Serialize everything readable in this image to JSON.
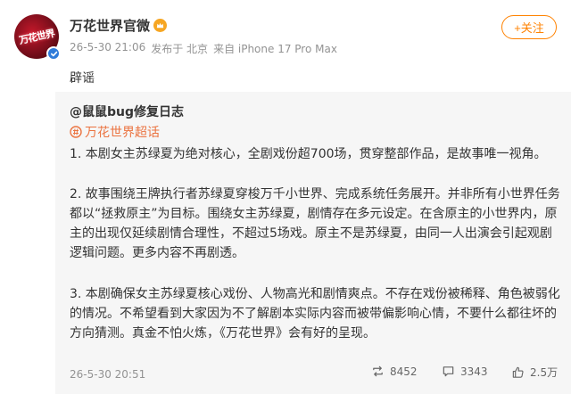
{
  "author": {
    "name": "万花世界官微",
    "avatar_text": "万花世界",
    "meta": [
      "26-5-30 21:06",
      "发布于 北京",
      "来自 iPhone 17 Pro Max"
    ]
  },
  "follow_label": "+关注",
  "post_text": "辟谣",
  "repost": {
    "author": "@鼠鼠bug修复日志",
    "topic": "万花世界超话",
    "paragraphs": [
      "1. 本剧女主苏绿夏为绝对核心，全剧戏份超700场，贯穿整部作品，是故事唯一视角。",
      "2. 故事围绕王牌执行者苏绿夏穿梭万千小世界、完成系统任务展开。并非所有小世界任务都以“拯救原主”为目标。围绕女主苏绿夏，剧情存在多元设定。在含原主的小世界内，原主的出现仅延续剧情合理性，不超过5场戏。原主不是苏绿夏，由同一人出演会引起观剧逻辑问题。更多内容不再剧透。",
      "3. 本剧确保女主苏绿夏核心戏份、人物高光和剧情爽点。不存在戏份被稀释、角色被弱化的情况。不希望看到大家因为不了解剧本实际内容而被带偏影响心情，不要什么都往坏的方向猜测。真金不怕火炼，《万花世界》会有好的呈现。"
    ],
    "time": "26-5-30 20:51",
    "reposts": "8452",
    "comments": "3343",
    "likes": "2.5万"
  },
  "colors": {
    "accent": "#ff8200",
    "topic": "#eb7340",
    "verified": "#2f7bd9",
    "vip": "#f6a623"
  },
  "icons": [
    "verified-badge-icon",
    "vip-crown-icon",
    "topic-icon",
    "repost-icon",
    "comment-icon",
    "like-icon"
  ]
}
